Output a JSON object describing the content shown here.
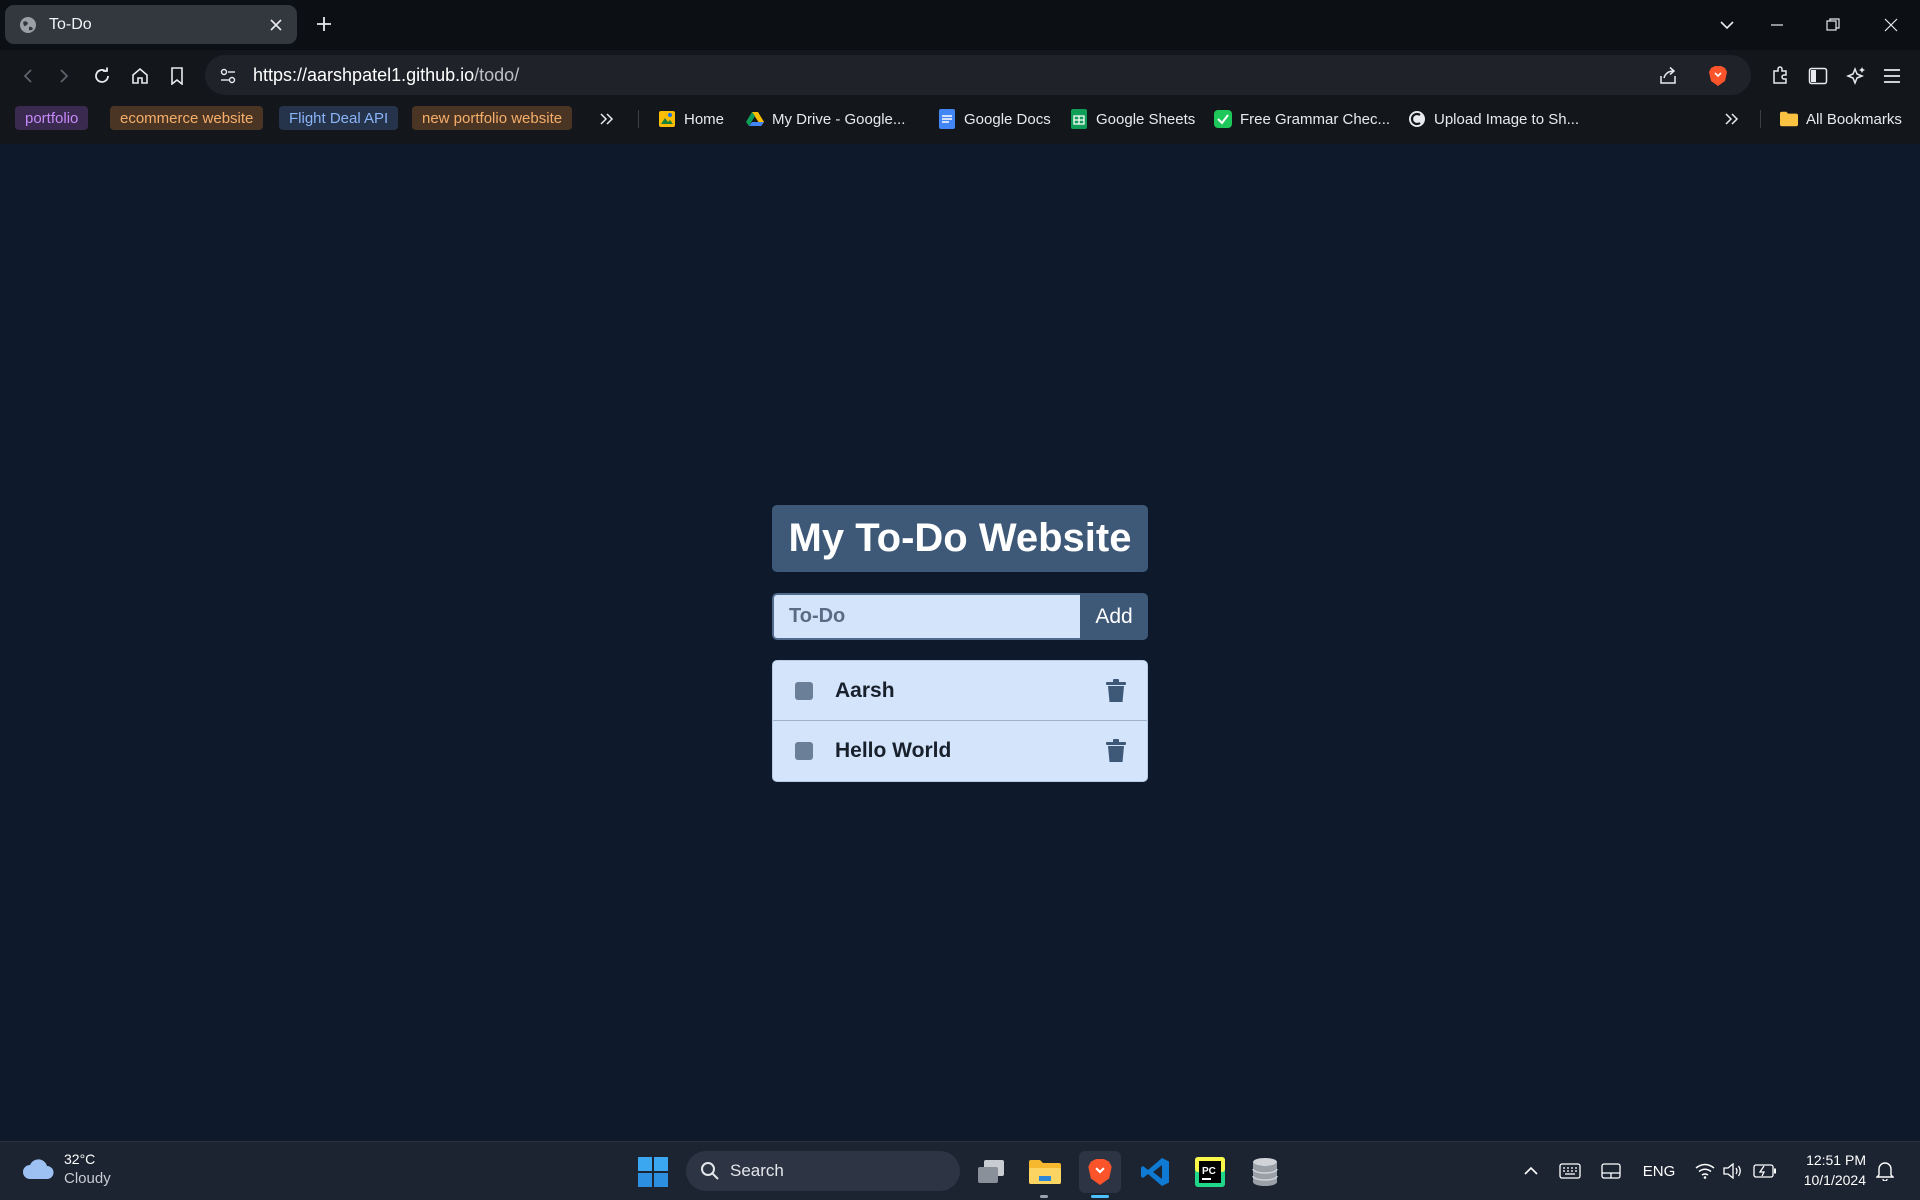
{
  "browser": {
    "tab_title": "To-Do",
    "url_host": "https://aarshpatel1.github.io",
    "url_path": "/todo/"
  },
  "bookmarks": {
    "tags": [
      {
        "label": "portfolio",
        "color": "#c58af9",
        "bg": "#3b2a4f"
      },
      {
        "label": "ecommerce website",
        "color": "#f6ae6a",
        "bg": "#4a3524"
      },
      {
        "label": "Flight Deal API",
        "color": "#8ab4f8",
        "bg": "#25344a"
      },
      {
        "label": "new portfolio website",
        "color": "#f6ae6a",
        "bg": "#4a3524"
      }
    ],
    "links": [
      {
        "label": "Home",
        "icon": "home-icon"
      },
      {
        "label": "My Drive - Google...",
        "icon": "google-drive-icon"
      },
      {
        "label": "Google Docs",
        "icon": "google-docs-icon"
      },
      {
        "label": "Google Sheets",
        "icon": "google-sheets-icon"
      },
      {
        "label": "Free Grammar Chec...",
        "icon": "grammar-check-icon"
      },
      {
        "label": "Upload Image to Sh...",
        "icon": "upload-image-icon"
      }
    ],
    "all_bookmarks": "All Bookmarks"
  },
  "app": {
    "title": "My To-Do Website",
    "input_placeholder": "To-Do",
    "add_label": "Add",
    "todos": [
      {
        "text": "Aarsh",
        "done": false
      },
      {
        "text": "Hello World",
        "done": false
      }
    ]
  },
  "taskbar": {
    "weather_temp": "32°C",
    "weather_cond": "Cloudy",
    "search_label": "Search",
    "language": "ENG",
    "time": "12:51 PM",
    "date": "10/1/2024"
  }
}
